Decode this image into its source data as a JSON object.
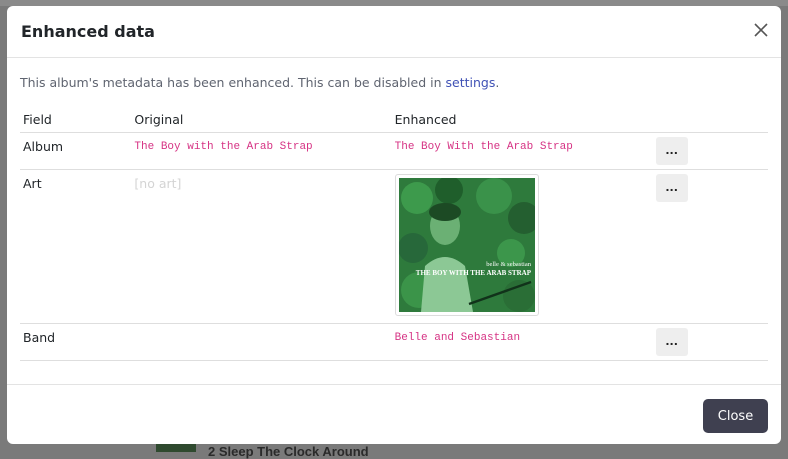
{
  "background": {
    "track_text": "2 Sleep The Clock Around"
  },
  "modal": {
    "title": "Enhanced data",
    "intro_text": "This album's metadata has been enhanced. This can be disabled in ",
    "intro_link": "settings",
    "intro_end": ".",
    "columns": {
      "field": "Field",
      "original": "Original",
      "enhanced": "Enhanced"
    },
    "rows": [
      {
        "field": "Album",
        "original": "The Boy with the Arab Strap",
        "enhanced": "The Boy With the Arab Strap",
        "action": "..."
      },
      {
        "field": "Art",
        "original": "[no art]",
        "action": "..."
      },
      {
        "field": "Band",
        "original": "",
        "enhanced": "Belle and Sebastian",
        "action": "..."
      }
    ],
    "art": {
      "band_text": "belle & sebastian",
      "album_text": "THE BOY WITH THE ARAB STRAP"
    },
    "close_label": "Close"
  },
  "colors": {
    "accent_link": "#3f51b5",
    "mono_text": "#d63384",
    "close_button": "#3f4050"
  }
}
